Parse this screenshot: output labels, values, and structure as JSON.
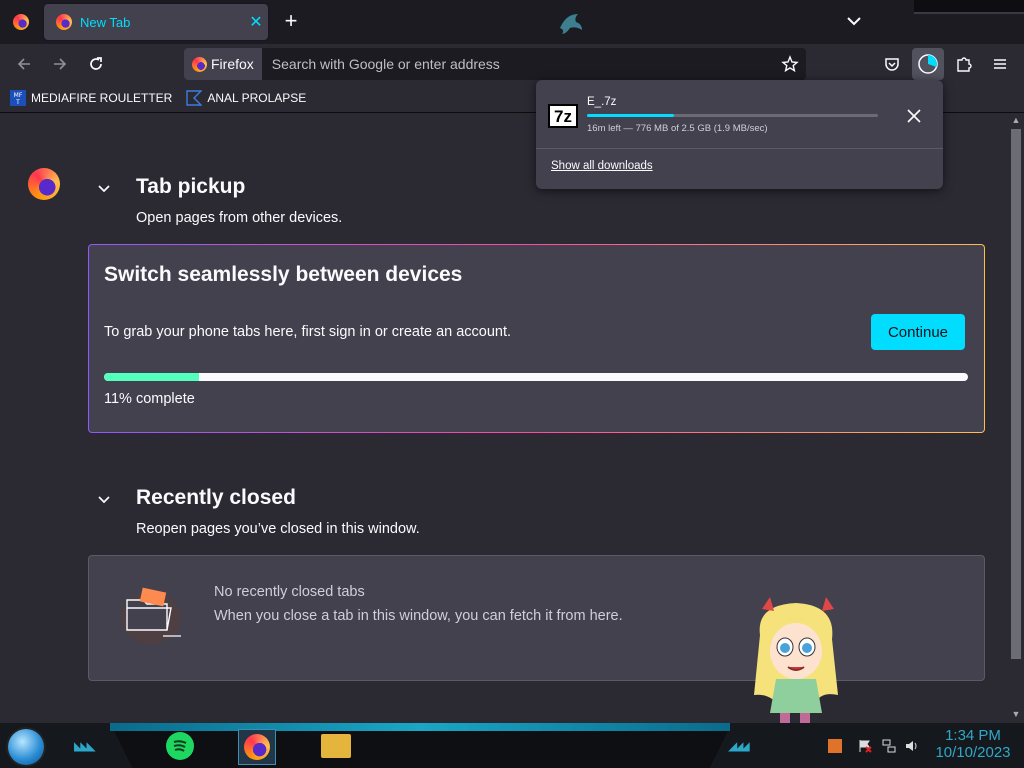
{
  "tabs": {
    "active_title": "New Tab",
    "close_glyph": "✕",
    "new_tab_glyph": "+"
  },
  "navbar": {
    "identity_label": "Firefox",
    "address_placeholder": "Search with Google or enter address"
  },
  "bookmarks": [
    {
      "label": "MEDIAFIRE ROULETTER",
      "icon": "mediafire-icon"
    },
    {
      "label": "ANAL PROLAPSE",
      "icon": "bookmark-flag-icon"
    }
  ],
  "downloads_panel": {
    "file_icon_text": "7z",
    "file_name": "E_.7z",
    "status": "16m left — 776 MB of 2.5 GB (1.9 MB/sec)",
    "progress": 0.3,
    "show_all_label": "Show all downloads"
  },
  "tab_pickup": {
    "title": "Tab pickup",
    "subtitle": "Open pages from other devices.",
    "card_title": "Switch seamlessly between devices",
    "card_description": "To grab your phone tabs here, first sign in or create an account.",
    "continue_label": "Continue",
    "progress_fraction": 0.11,
    "progress_label": "11% complete"
  },
  "recently_closed": {
    "title": "Recently closed",
    "subtitle": "Reopen pages you’ve closed in this window.",
    "empty_title": "No recently closed tabs",
    "empty_description": "When you close a tab in this window, you can fetch it from here."
  },
  "taskbar": {
    "time": "1:34 PM",
    "date": "10/10/2023"
  },
  "colors": {
    "accent": "#00ddff",
    "progress_green": "#54ffbd",
    "background": "#2b2a33",
    "card": "#42414d"
  }
}
